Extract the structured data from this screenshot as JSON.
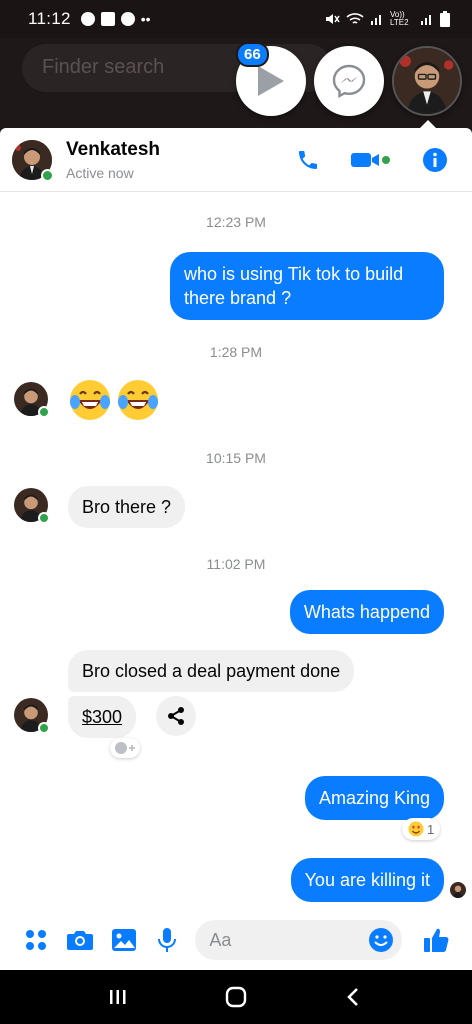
{
  "status_bar": {
    "time": "11:12",
    "network_label": "Vo)) LTE2"
  },
  "chat_heads": {
    "search_placeholder": "Finder search",
    "badge_count": "66"
  },
  "header": {
    "name": "Venkatesh",
    "status": "Active now"
  },
  "messages": {
    "ts1": "12:23 PM",
    "out1": "who is using Tik tok to build there brand ?",
    "ts2": "1:28 PM",
    "in_emoji": [
      "laughing-tears-emoji",
      "laughing-tears-emoji"
    ],
    "ts3": "10:15 PM",
    "in1": "Bro there ?",
    "ts4": "11:02 PM",
    "out2": "Whats happend",
    "in2": "Bro closed a deal payment done",
    "in3": "$300",
    "out3": "Amazing King",
    "out3_reaction_count": "1",
    "out4": "You are killing it"
  },
  "composer": {
    "placeholder": "Aa"
  },
  "colors": {
    "accent": "#0a7cff",
    "online": "#31a24c",
    "incoming_bubble": "#f0f0f0"
  }
}
